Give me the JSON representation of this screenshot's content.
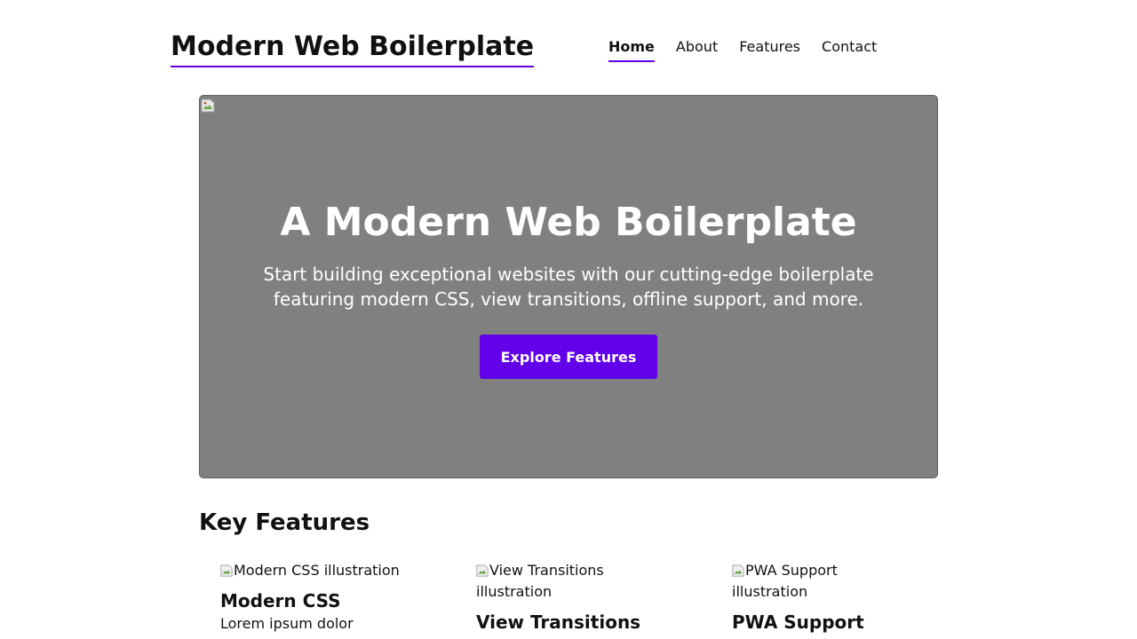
{
  "site": {
    "title": "Modern Web Boilerplate"
  },
  "nav": {
    "items": [
      {
        "label": "Home",
        "active": true
      },
      {
        "label": "About",
        "active": false
      },
      {
        "label": "Features",
        "active": false
      },
      {
        "label": "Contact",
        "active": false
      }
    ]
  },
  "hero": {
    "title": "A Modern Web Boilerplate",
    "subtitle": "Start building exceptional websites with our cutting-edge boilerplate featuring modern CSS, view transitions, offline support, and more.",
    "cta_label": "Explore Features",
    "image_icon": "broken-image-icon"
  },
  "features": {
    "heading": "Key Features",
    "items": [
      {
        "image_alt": "Modern CSS illustration",
        "title": "Modern CSS",
        "description": "Lorem ipsum dolor"
      },
      {
        "image_alt": "View Transitions illustration",
        "title": "View Transitions",
        "description": ""
      },
      {
        "image_alt": "PWA Support illustration",
        "title": "PWA Support",
        "description": ""
      }
    ]
  },
  "colors": {
    "accent": "#6200ea",
    "hero_background": "#808080",
    "text": "#111111",
    "on_accent": "#ffffff"
  }
}
